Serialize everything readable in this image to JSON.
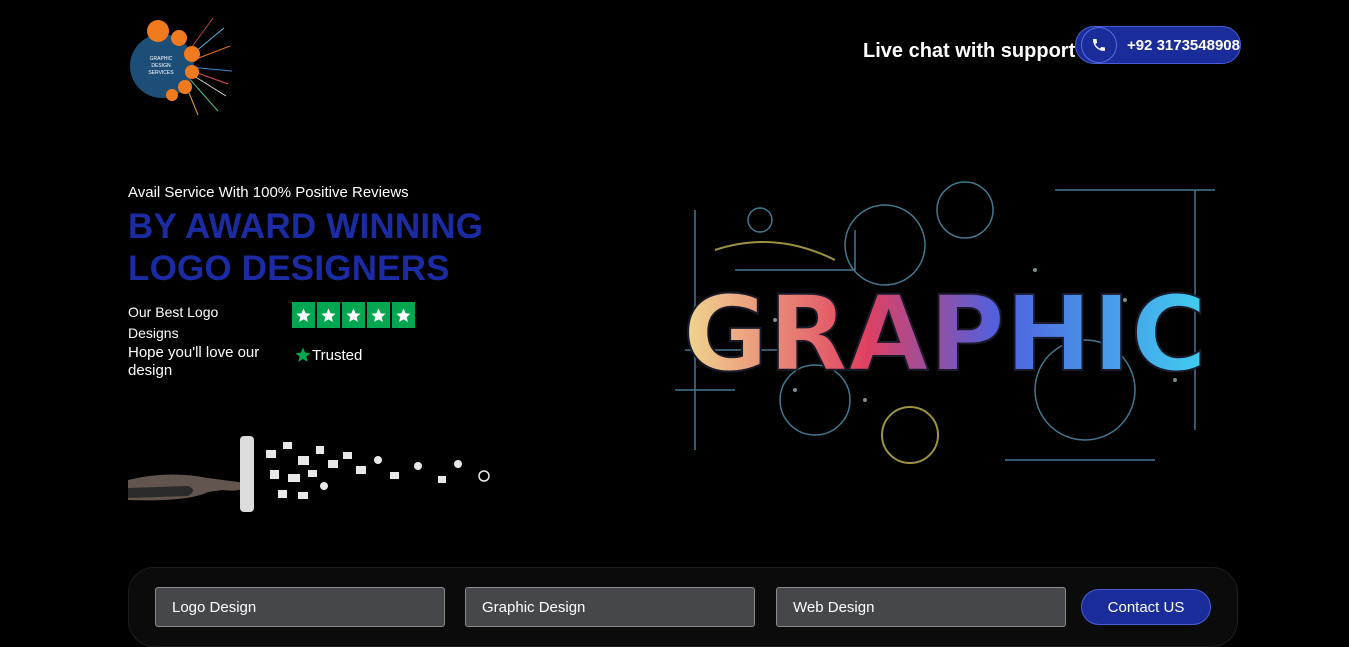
{
  "brand": {
    "logo_lines": [
      "GRAPHIC",
      "DESIGN",
      "SERVICES"
    ]
  },
  "header": {
    "support_text": "Live chat with support",
    "phone": "+92 3173548908"
  },
  "hero": {
    "kicker": "Avail Service With 100% Positive Reviews",
    "headline_line1": "BY AWARD WINNING",
    "headline_line2": "LOGO DESIGNERS",
    "best_text": "Our Best Logo Designs",
    "hope_text": "Hope you'll love our design",
    "rating_stars": 5,
    "trusted_label": "Trusted",
    "graphic_word": "GRAPHIC"
  },
  "form": {
    "fields": [
      "Logo Design",
      "Graphic Design",
      "Web Design"
    ],
    "button_label": "Contact US"
  },
  "colors": {
    "accent_blue": "#1b2ba3",
    "button_blue": "#1a2c9a",
    "trust_green": "#00a650",
    "background": "#000000"
  }
}
